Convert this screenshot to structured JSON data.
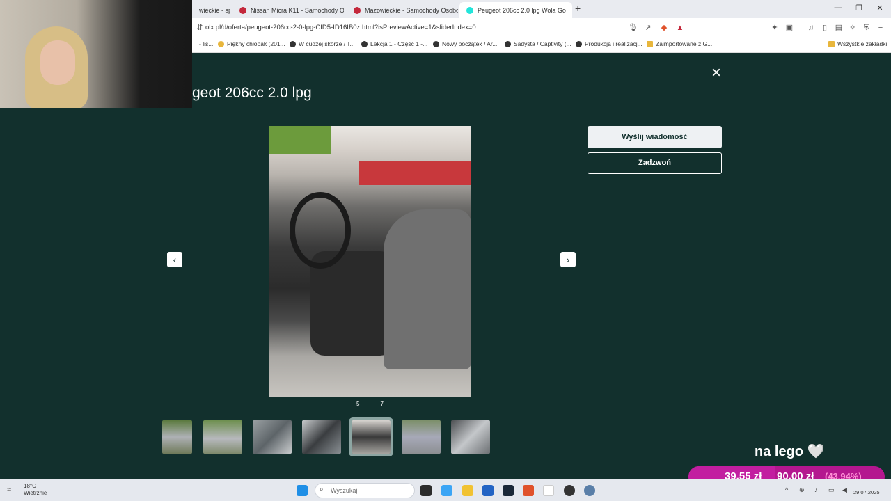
{
  "browser": {
    "tabs": [
      {
        "label": "wieckie - sp",
        "active": false
      },
      {
        "label": "Nissan Micra K11 - Samochody Osob",
        "active": false
      },
      {
        "label": "Mazowieckie - Samochody Osobowe",
        "active": false
      },
      {
        "label": "Peugeot 206cc 2.0 lpg Wola Go",
        "active": true
      }
    ],
    "new_tab": "+",
    "url": "olx.pl/d/oferta/peugeot-206cc-2-0-lpg-CID5-ID16IB0z.html?isPreviewActive=1&sliderIndex=0",
    "bookmarks": [
      "- lis...",
      "Piękny chłopak (201...",
      "W cudzej skórze / T...",
      "Lekcja 1 - Część 1 -...",
      "Nowy początek / Ar...",
      "Sadysta / Captivity (...",
      "Produkcja i realizacj...",
      "Zaimportowane z G...",
      "Wszystkie zakładki"
    ]
  },
  "gallery": {
    "title": "geot 206cc 2.0 lpg",
    "close_icon": "×",
    "prev_icon": "‹",
    "next_icon": "›",
    "counter_current": "5",
    "counter_total": "7",
    "thumbnails_count": 7,
    "selected_thumbnail": 5
  },
  "actions": {
    "message_label": "Wyślij wiadomość",
    "call_label": "Zadzwoń"
  },
  "overlay": {
    "text": "na lego 🤍",
    "donation_current": "39,55 zł",
    "donation_goal": "90,00 zł",
    "donation_percent": "(43,94%)",
    "progress_fraction": 0.44
  },
  "taskbar": {
    "temperature": "18°C",
    "weather": "Wietrznie",
    "search_placeholder": "Wyszukaj",
    "date": "29.07.2025"
  },
  "colors": {
    "background": "#12302d",
    "accent_donate": "#b4178f"
  }
}
